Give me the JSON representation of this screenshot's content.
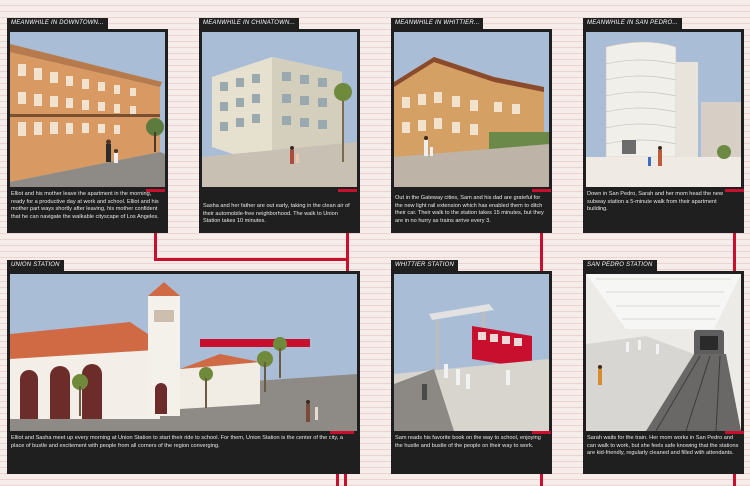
{
  "panels": [
    {
      "tag": "MEANWHILE IN DOWNTOWN...",
      "caption": "Elliot and his mother leave the apartment in the morning, ready for a productive day at work and school. Elliot and his mother part ways shortly after leaving, his mother confident that he can navigate the walkable cityscape of Los Angeles."
    },
    {
      "tag": "MEANWHILE IN CHINATOWN...",
      "caption": "Sasha and her father are out early, taking in the clean air of their automobile-free neighborhood. The walk to Union Station takes 10 minutes."
    },
    {
      "tag": "MEANWHILE IN WHITTIER...",
      "caption": "Out in the Gateway cities, Sam and his dad are grateful for the new light rail extension which has enabled them to ditch their car. Their walk to the station takes 15 minutes, but they are in no hurry as trains arrive every 3."
    },
    {
      "tag": "MEANWHILE IN SAN PEDRO...",
      "caption": "Down in San Pedro, Sarah and her mom head the new subway station a 5-minute walk from their apartment building."
    },
    {
      "tag": "UNION STATION",
      "caption": "Elliot and Sasha meet up every morning at Union Station to start their ride to school. For them, Union Station is the center of the city, a place of bustle and excitement with people from all corners of the region converging."
    },
    {
      "tag": "WHITTIER STATION",
      "caption": "Sam reads his favorite book on the way to school, enjoying the hustle and bustle of the people on their way to work."
    },
    {
      "tag": "SAN PEDRO STATION",
      "caption": "Sarah waits for the train. Her mom works in San Pedro and can walk to work, but she feels safe knowing that the stations are kid-friendly, regularly cleaned and filled with attendants."
    }
  ],
  "colors": {
    "wire": "#c8102e",
    "panel": "#1f1f1f",
    "sky": "#a9bed6",
    "ground": "#8e8a86"
  }
}
